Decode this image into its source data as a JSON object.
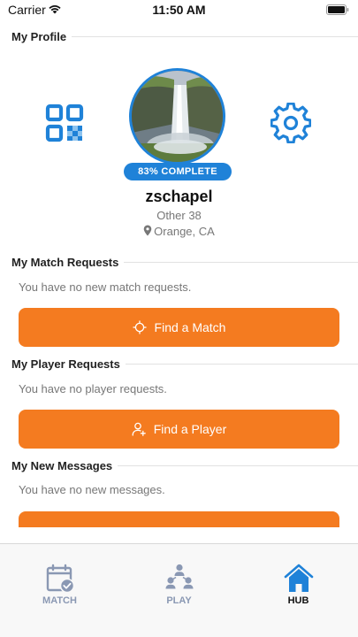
{
  "status_bar": {
    "carrier": "Carrier",
    "time": "11:50 AM",
    "wifi_icon": "wifi-icon",
    "battery_icon": "battery-icon"
  },
  "profile": {
    "section_title": "My Profile",
    "qr_icon": "qr-code-icon",
    "settings_icon": "gear-icon",
    "avatar_image": "waterfall landscape",
    "completion_badge": "83% COMPLETE",
    "completion_percent": 83,
    "username": "zschapel",
    "subinfo": "Other 38",
    "location": "Orange, CA",
    "location_icon": "map-pin-icon"
  },
  "match_requests": {
    "section_title": "My Match Requests",
    "empty_text": "You have no new match requests.",
    "button_label": "Find a Match",
    "button_icon": "crosshair-icon"
  },
  "player_requests": {
    "section_title": "My Player Requests",
    "empty_text": "You have no player requests.",
    "button_label": "Find a Player",
    "button_icon": "add-user-icon"
  },
  "messages": {
    "section_title": "My New Messages",
    "empty_text": "You have no new messages."
  },
  "tab_bar": {
    "tabs": [
      {
        "label": "MATCH",
        "icon": "calendar-check-icon",
        "active": false
      },
      {
        "label": "PLAY",
        "icon": "people-group-icon",
        "active": false
      },
      {
        "label": "HUB",
        "icon": "home-icon",
        "active": true
      }
    ]
  },
  "colors": {
    "accent_blue": "#1f82d8",
    "button_orange": "#f47b20",
    "tab_inactive": "#8a98b3",
    "text_muted": "#777777"
  }
}
